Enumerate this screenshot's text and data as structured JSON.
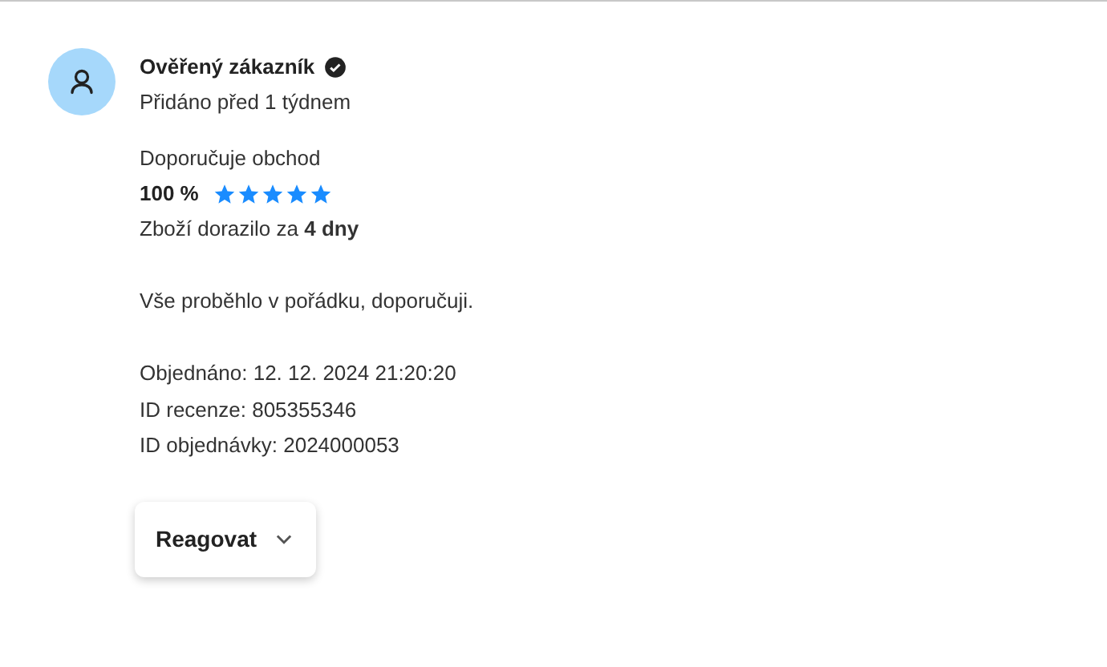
{
  "reviewer": {
    "name": "Ověřený zákazník",
    "verified": true,
    "added": "Přidáno před 1 týdnem"
  },
  "recommendation": {
    "label": "Doporučuje obchod",
    "percent": "100 %",
    "stars": 5
  },
  "delivery": "Zboží dorazilo za **4 dny**",
  "comment": "Vše proběhlo v pořádku, doporučuji.",
  "details": [
    "Objednáno: 12. 12. 2024 21:20:20",
    "ID recenze: 805355346",
    "ID objednávky: 2024000053"
  ],
  "button": {
    "label": "Reagovat"
  }
}
